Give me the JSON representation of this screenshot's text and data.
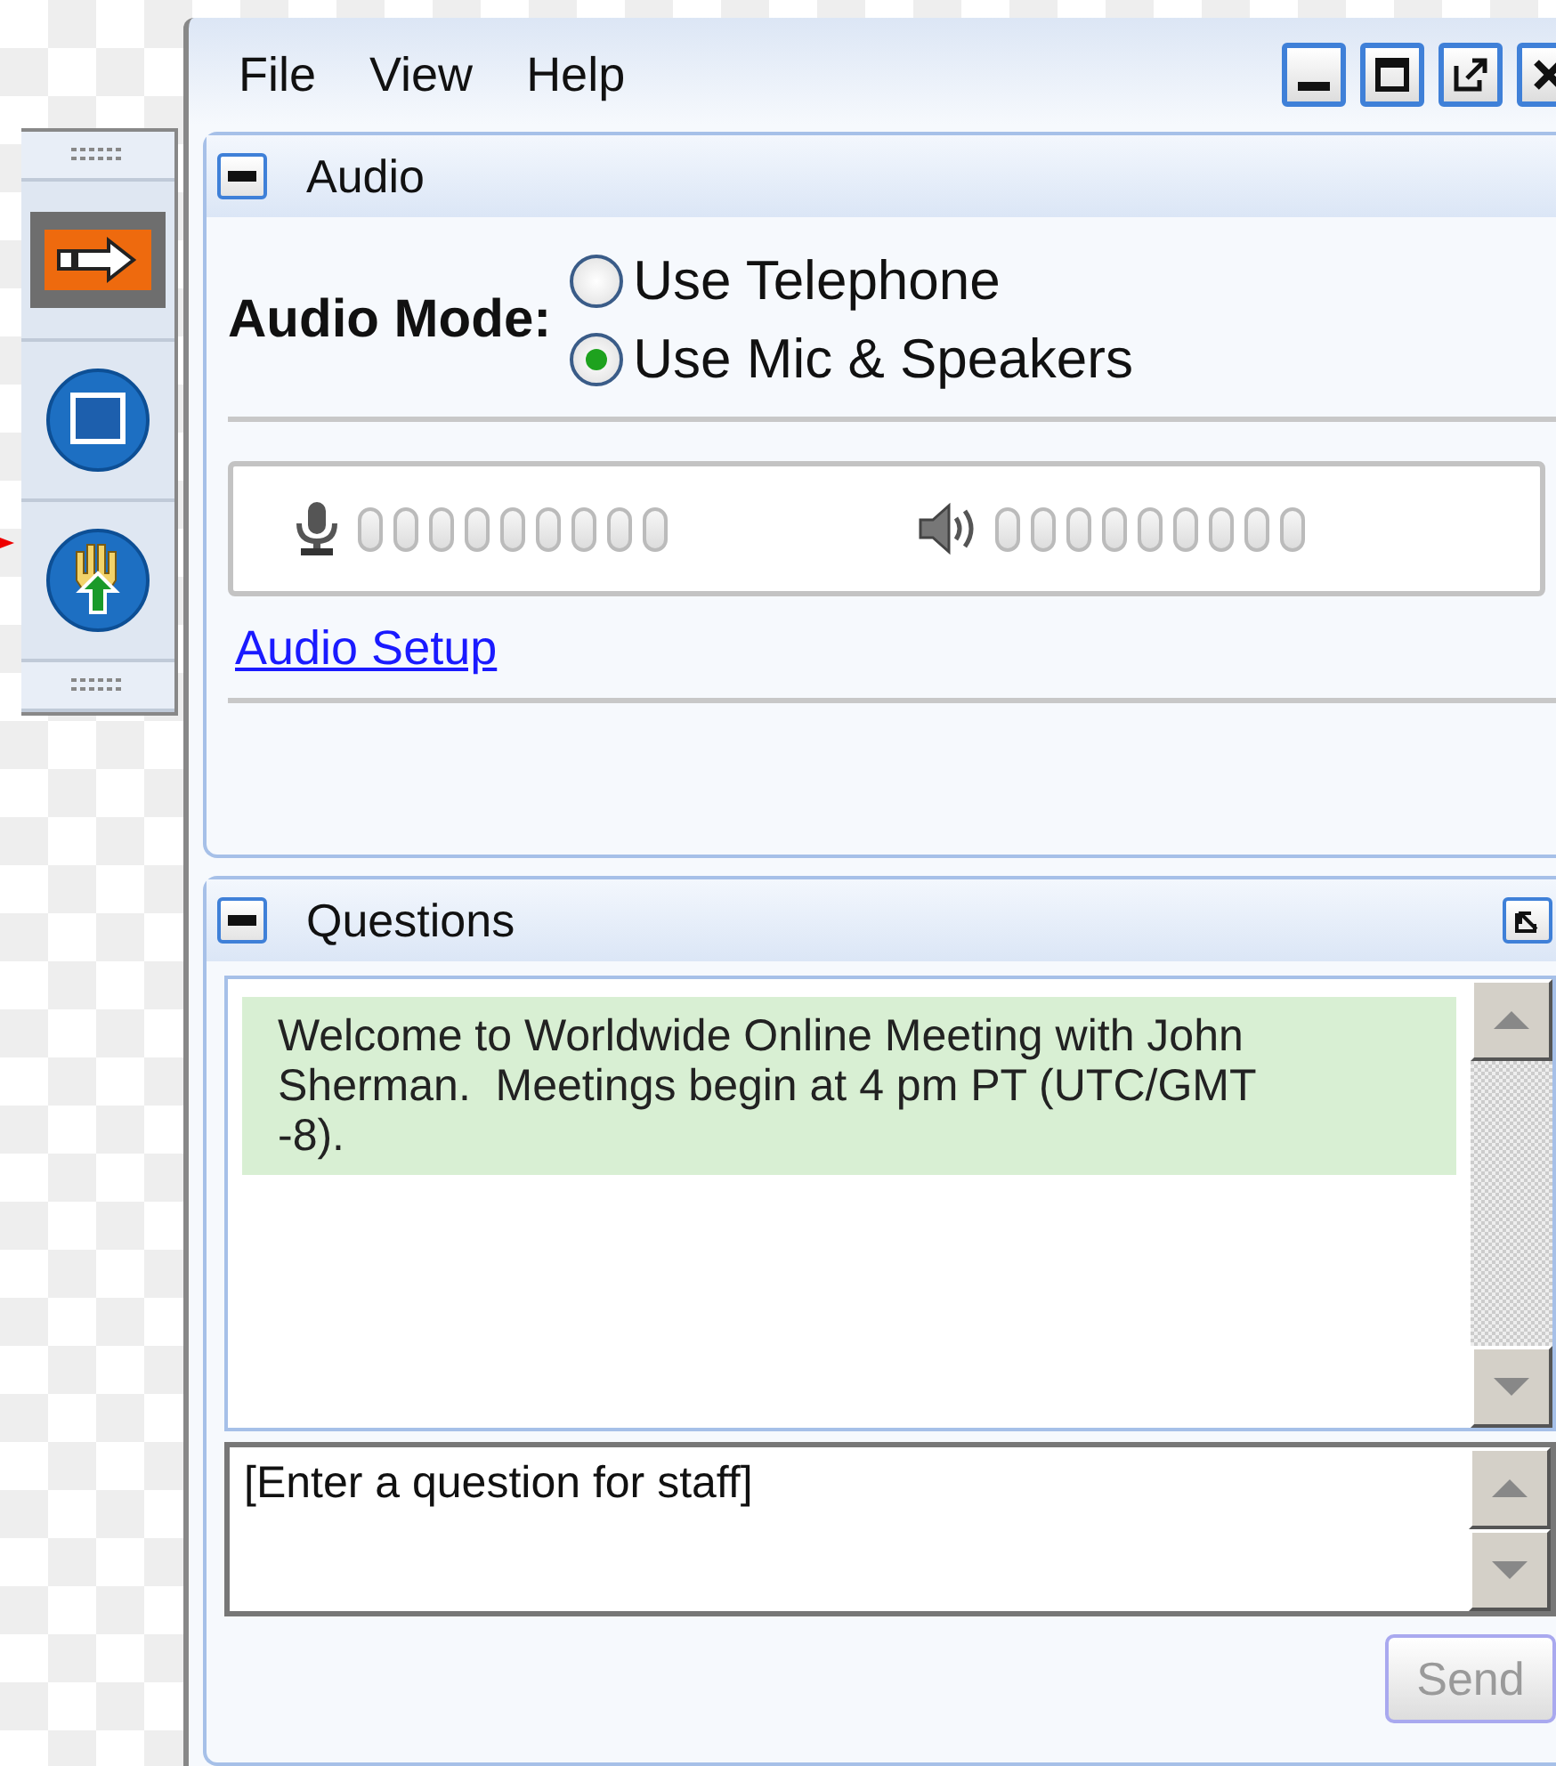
{
  "toolbar": {
    "items": [
      {
        "kind": "arrow",
        "selected": true
      },
      {
        "kind": "stop",
        "selected": false
      },
      {
        "kind": "raise-hand",
        "selected": false
      }
    ]
  },
  "window": {
    "menu": [
      "File",
      "View",
      "Help"
    ]
  },
  "audio_panel": {
    "title": "Audio",
    "mode_label": "Audio Mode:",
    "modes": [
      {
        "label": "Use Telephone",
        "selected": false
      },
      {
        "label": "Use Mic & Speakers",
        "selected": true
      }
    ],
    "meters": [
      {
        "kind": "mic"
      },
      {
        "kind": "speaker"
      }
    ],
    "setup_link": "Audio Setup"
  },
  "questions_panel": {
    "title": "Questions",
    "messages": [
      "Welcome to Worldwide Online Meeting with John Sherman.  Meetings begin at 4 pm PT (UTC/GMT -8)."
    ],
    "input": {
      "placeholder": "[Enter a question for staff]"
    },
    "send_button": {
      "label": "Send",
      "disabled": true
    }
  }
}
